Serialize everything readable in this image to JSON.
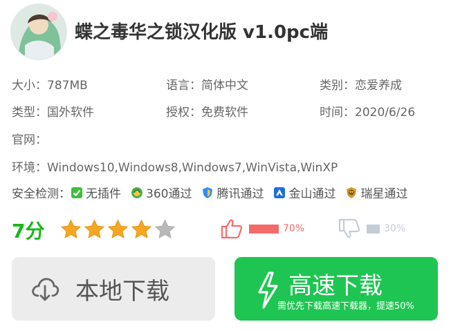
{
  "app": {
    "title": "蝶之毒华之锁汉化版 v1.0pc端"
  },
  "info": {
    "size": "大小：787MB",
    "language": "语言：简体中文",
    "category": "类别：恋爱养成",
    "type": "类型：国外软件",
    "license": "授权：免费软件",
    "date": "时间：2020/6/26",
    "website": "官网：",
    "environment": "环境：Windows10,Windows8,Windows7,WinVista,WinXP"
  },
  "safety": {
    "label": "安全检测：",
    "items": [
      {
        "text": "无插件",
        "icon": "check-icon",
        "color": "#3cbf3c"
      },
      {
        "text": "360通过",
        "icon": "360-icon",
        "color": "#4caf50"
      },
      {
        "text": "腾讯通过",
        "icon": "tencent-shield-icon",
        "color": "#2d8cf0"
      },
      {
        "text": "金山通过",
        "icon": "kingsoft-icon",
        "color": "#1f6fd1"
      },
      {
        "text": "瑞星通过",
        "icon": "rising-lion-icon",
        "color": "#d89a1f"
      }
    ]
  },
  "rating": {
    "score": "7分",
    "stars_filled": 4,
    "stars_total": 5
  },
  "votes": {
    "up_percent": "70%",
    "up_fraction": 0.7,
    "up_color": "#f26b6b",
    "down_percent": "30%",
    "down_fraction": 0.3,
    "down_color": "#c4cdd6"
  },
  "buttons": {
    "local": "本地下载",
    "fast": "高速下载",
    "fast_sub": "需优先下载高速下载器，提速50%"
  }
}
